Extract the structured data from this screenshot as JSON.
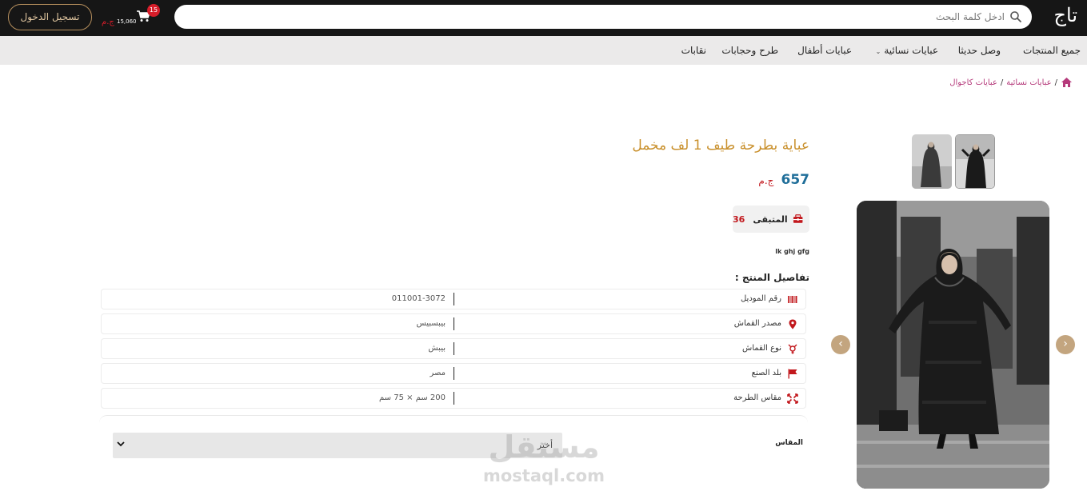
{
  "header": {
    "logo_text": "تاج",
    "search_placeholder": "ادخل كلمة البحث",
    "cart": {
      "badge": "15",
      "total": "15,060",
      "currency": "ج.م"
    },
    "login_label": "تسجيل الدخول"
  },
  "nav": {
    "items": [
      {
        "label": "جميع المنتجات"
      },
      {
        "label": "وصل حديثا"
      },
      {
        "label": "عبايات نسائية",
        "has_dropdown": true
      },
      {
        "label": "عبايات أطفال"
      },
      {
        "label": "طرح وحجابات"
      },
      {
        "label": "نقابات"
      }
    ]
  },
  "breadcrumb": {
    "items": [
      "عبايات نسائية",
      "عبايات كاجوال"
    ]
  },
  "product": {
    "title": "عباية بطرحة طيف 1 لف مخمل",
    "price": "657",
    "currency": "ج.م",
    "stock_label": "المتبقى",
    "stock_count": "36",
    "short_description": "lk ghj gfg",
    "details_heading": "تفاصيل المنتج :",
    "details": [
      {
        "icon": "barcode-icon",
        "label": "رقم الموديل",
        "value": "011001-3072"
      },
      {
        "icon": "map-pin-icon",
        "label": "مصدر القماش",
        "value": "بيبسبيس"
      },
      {
        "icon": "gender-icon",
        "label": "نوع القماش",
        "value": "بيبش"
      },
      {
        "icon": "flag-icon",
        "label": "بلد الصنع",
        "value": "مصر"
      },
      {
        "icon": "resize-icon",
        "label": "مقاس الطرحة",
        "value": "200 سم × 75 سم"
      }
    ],
    "size_label": "المقاس",
    "size_select_value": "أختر"
  },
  "watermark": {
    "arabic": "مستقل",
    "latin": "mostaql.com"
  },
  "colors": {
    "topbar": "#161616",
    "nav_bg": "#ebeaea",
    "accent_gold": "#c9902c",
    "price_blue": "#1f6e99",
    "red": "#c2181d",
    "arrow_tan": "#c3a57f",
    "breadcrumb_pink": "#b53a7b"
  }
}
